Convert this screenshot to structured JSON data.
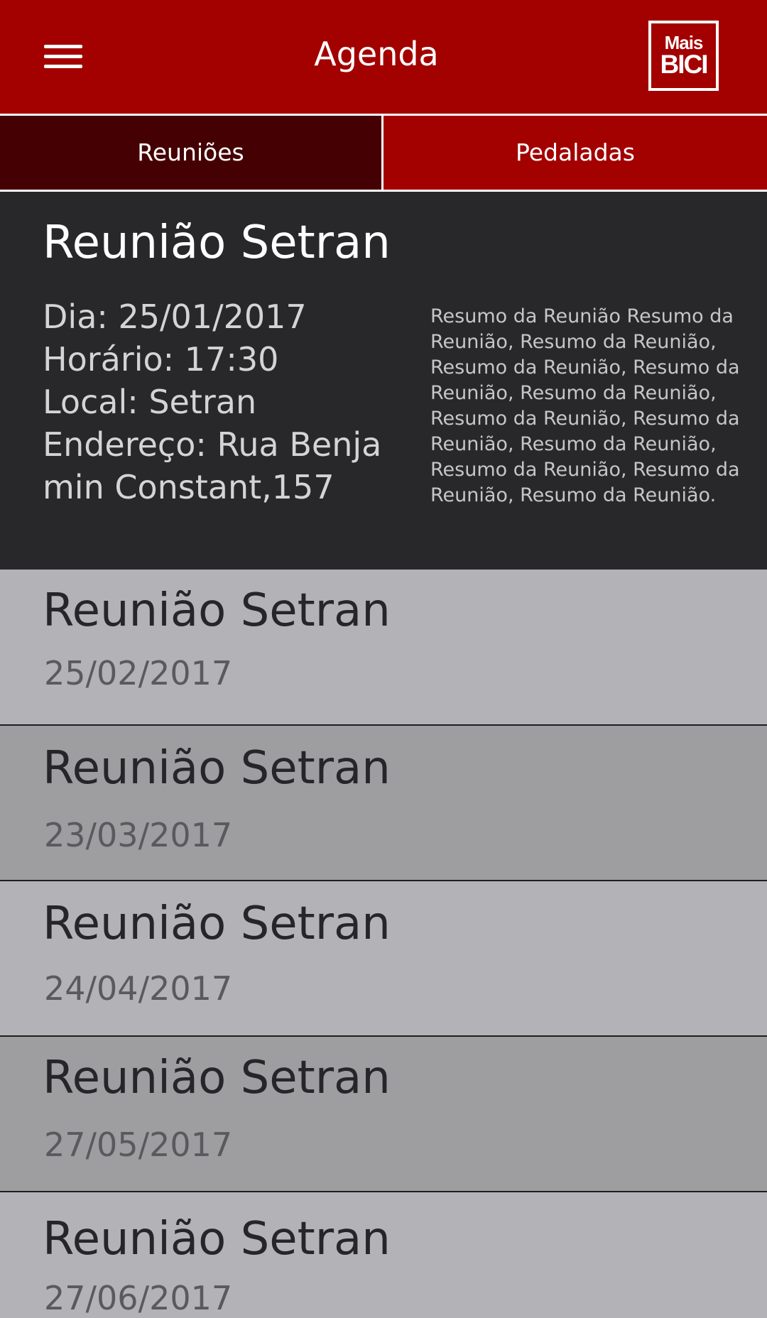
{
  "header": {
    "title": "Agenda",
    "logo_line1": "Mais",
    "logo_line2": "BICI"
  },
  "tabs": [
    {
      "label": "Reuniões",
      "selected": true
    },
    {
      "label": "Pedaladas",
      "selected": false
    }
  ],
  "expanded_meeting": {
    "title": "Reunião Setran",
    "day": "Dia: 25/01/2017",
    "time": "Horário: 17:30",
    "place": "Local: Setran",
    "address_line1": "Endereço: Rua Benja",
    "address_line2": "min Constant,157",
    "summary": "Resumo da Reunião Resumo da Reunião, Resumo da Reunião, Resumo da Reunião, Resumo da Reunião, Resumo da Reunião, Resumo da Reunião, Resumo da Reunião, Resumo da Reunião, Resumo da Reunião, Resumo da Reunião, Resumo da Reunião."
  },
  "meetings": [
    {
      "title": "Reunião Setran",
      "date": "25/02/2017"
    },
    {
      "title": "Reunião Setran",
      "date": "23/03/2017"
    },
    {
      "title": "Reunião Setran",
      "date": "24/04/2017"
    },
    {
      "title": "Reunião Setran",
      "date": "27/05/2017"
    },
    {
      "title": "Reunião Setran",
      "date": "27/06/2017"
    }
  ],
  "colors": {
    "primary": "#a30000",
    "tab_selected": "#450003",
    "card_dark": "#28282a",
    "row_light": "#b3b3b7",
    "row_dark": "#9e9ea0"
  },
  "icons": {
    "menu": "hamburger-menu-icon",
    "logo": "mais-bici-logo"
  }
}
